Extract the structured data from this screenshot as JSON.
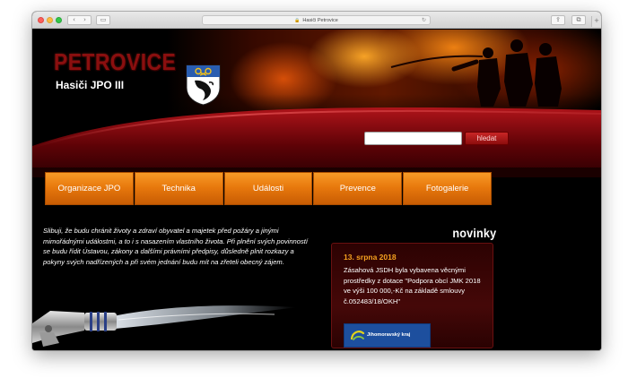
{
  "browser": {
    "url_text": "Hasiči Petrovice",
    "nav_back_label": "‹",
    "nav_forward_label": "›",
    "sidebar_label": "▭",
    "share_label": "⇪",
    "tabs_label": "⧉",
    "newtab_label": "+",
    "lock_label": "🔒",
    "reload_label": "↻"
  },
  "header": {
    "site_name": "PETROVICE",
    "subtitle": "Hasiči JPO III"
  },
  "search": {
    "value": "",
    "button_label": "hledat"
  },
  "nav": {
    "items": [
      {
        "label": "Organizace JPO"
      },
      {
        "label": "Technika"
      },
      {
        "label": "Události"
      },
      {
        "label": "Prevence"
      },
      {
        "label": "Fotogalerie"
      }
    ]
  },
  "oath": {
    "text": "Slibuji, že budu chránit životy a zdraví obyvatel a majetek před požáry a jinými mimořádnými událostmi, a to i s nasazením vlastního života. Při plnění svých povinností se budu řídit Ústavou, zákony a dalšími právními předpisy, důsledně plnit rozkazy a pokyny svých nadřízených a při svém jednání budu mít na zřeteli obecný zájem."
  },
  "news": {
    "heading": "novinky",
    "date": "13. srpna 2018",
    "text": "Zásahová JSDH byla vybavena věcnými prostředky z dotace \"Podpora obcí JMK 2018 ve výši 100 000,-Kč na základě smlouvy č.052483/18/OKH\"",
    "sponsor_label": "Jihomoravský kraj"
  },
  "colors": {
    "nav_orange": "#e8790d",
    "brand_red": "#8a0f0f",
    "date_orange": "#f6a21f"
  }
}
